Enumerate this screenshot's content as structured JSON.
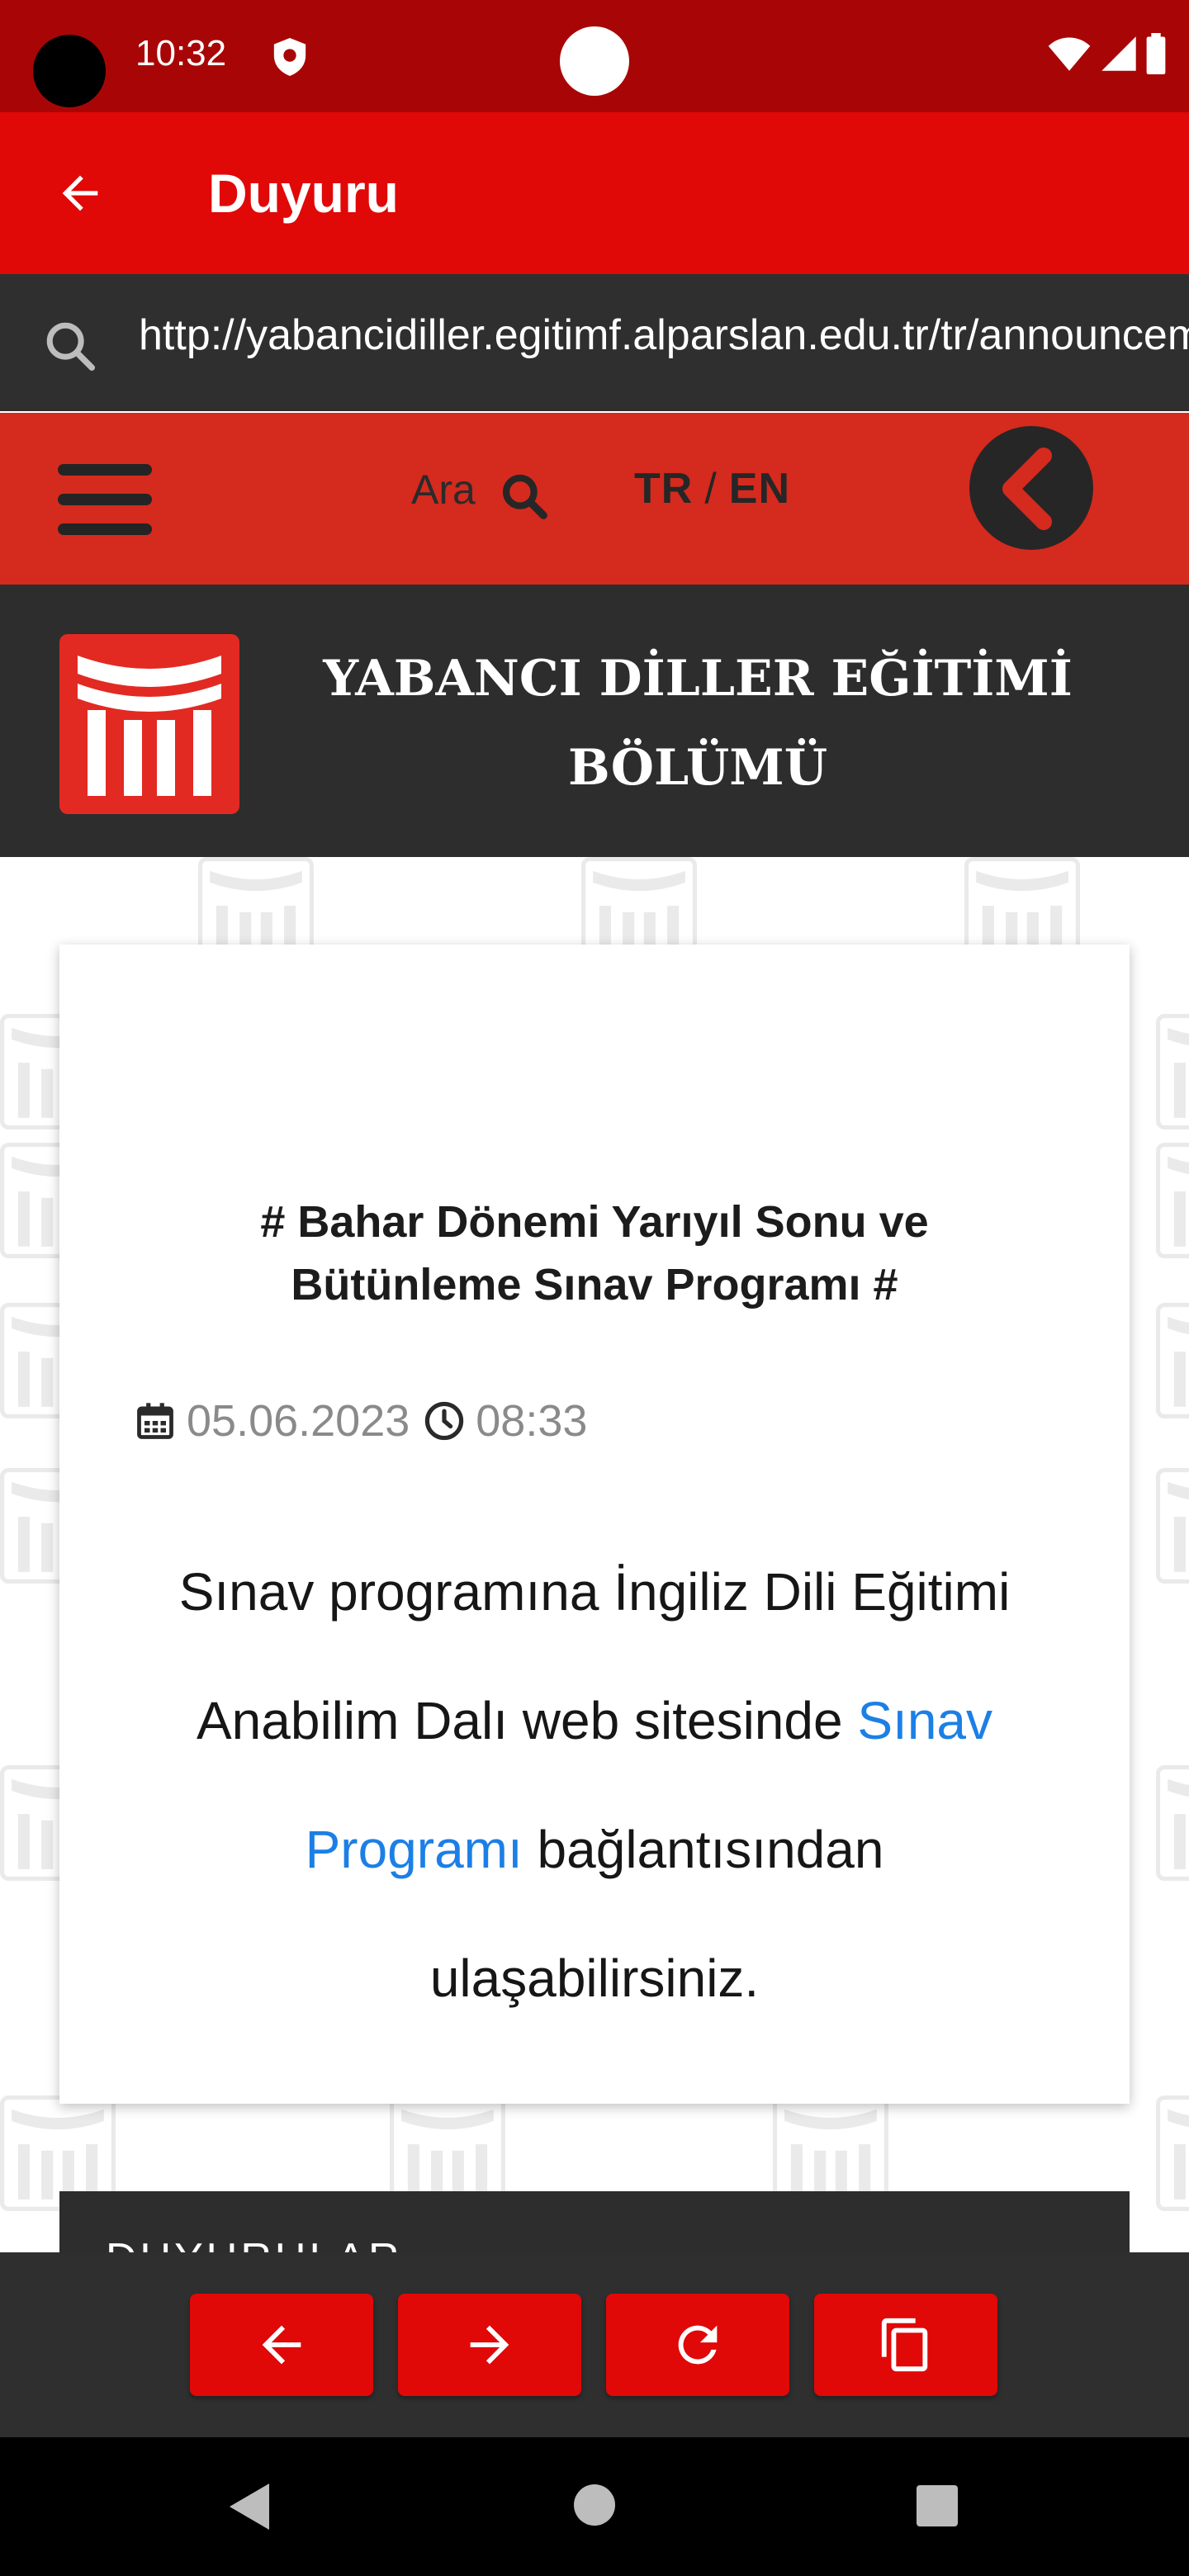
{
  "status_bar": {
    "time": "10:32",
    "background_color": "#a80606",
    "icons": [
      "shield-icon",
      "wifi-icon",
      "signal-icon",
      "battery-icon"
    ]
  },
  "app_bar": {
    "title": "Duyuru",
    "back_icon": "arrow-left-icon",
    "background_color": "#e10808"
  },
  "url_bar": {
    "url": "http://yabancidiller.egitimf.alparslan.edu.tr/tr/announcements",
    "search_icon": "search-icon"
  },
  "site_nav": {
    "menu_icon": "hamburger-icon",
    "search_label": "Ara",
    "lang_tr": "TR",
    "lang_separator": "/",
    "lang_en": "EN",
    "collapse_icon": "chevron-left-icon",
    "background_color": "#d52a1e"
  },
  "department": {
    "title": "YABANCI DİLLER EĞİTİMİ BÖLÜMÜ",
    "logo": "university-logo"
  },
  "announcement": {
    "title": "# Bahar Dönemi Yarıyıl Sonu ve Bütünleme Sınav Programı #",
    "date": "05.06.2023",
    "time": "08:33",
    "body_before_link": "Sınav programına İngiliz Dili Eğitimi Anabilim Dalı web sitesinde ",
    "body_link": "Sınav Programı",
    "body_after_link": " bağlantısından ulaşabilirsiniz.",
    "link_color": "#1c7fe6"
  },
  "news_panel": {
    "title": "DUYURULAR"
  },
  "browser_toolbar": {
    "buttons": [
      {
        "icon": "arrow-left-icon",
        "action": "back"
      },
      {
        "icon": "arrow-right-icon",
        "action": "forward"
      },
      {
        "icon": "refresh-icon",
        "action": "reload"
      },
      {
        "icon": "copy-icon",
        "action": "copy"
      }
    ],
    "button_color": "#e10808"
  },
  "android_nav": {
    "buttons": [
      "back-triangle-icon",
      "home-circle-icon",
      "recents-square-icon"
    ]
  }
}
